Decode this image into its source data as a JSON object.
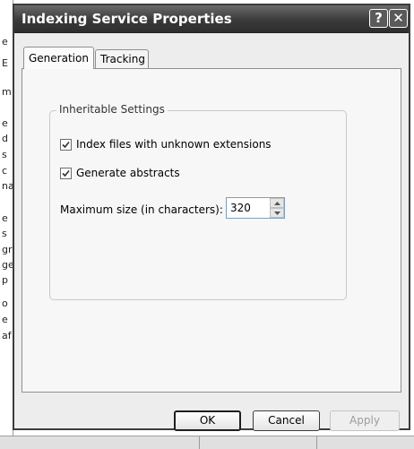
{
  "dialog": {
    "title": "Indexing Service Properties",
    "help_glyph": "?",
    "close_glyph": "✕"
  },
  "tabs": [
    {
      "label": "Generation",
      "active": true
    },
    {
      "label": "Tracking",
      "active": false
    }
  ],
  "group": {
    "label": "Inheritable Settings",
    "index_unknown": {
      "label": "Index files with unknown extensions",
      "checked": true
    },
    "generate_abstracts": {
      "label": "Generate abstracts",
      "checked": true
    },
    "max_size": {
      "label": "Maximum size (in characters):",
      "value": "320"
    }
  },
  "buttons": {
    "ok": "OK",
    "cancel": "Cancel",
    "apply": "Apply"
  },
  "background_fragments": [
    "e",
    "E",
    "m",
    "e",
    "d",
    "s",
    "c",
    "na",
    "e",
    "s",
    "gr",
    "ge",
    "p",
    "o",
    "e",
    "af"
  ],
  "colors": {
    "titlebar": "#3a3a3a",
    "dialog_bg": "#ededed",
    "panel_bg": "#f7f7f7"
  }
}
